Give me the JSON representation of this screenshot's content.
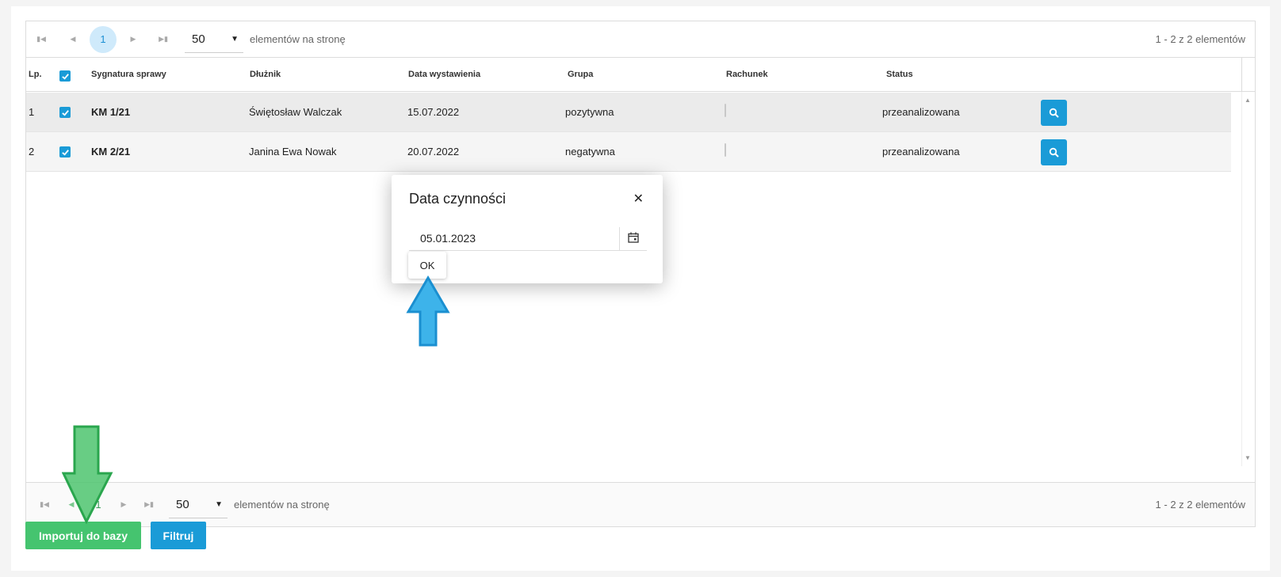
{
  "pager_top": {
    "first_icon": "first-page-icon",
    "prev_icon": "prev-page-icon",
    "current_page": "1",
    "next_icon": "next-page-icon",
    "last_icon": "last-page-icon",
    "page_size": "50",
    "page_size_label": "elementów na stronę",
    "info": "1 - 2 z 2 elementów"
  },
  "pager_bottom": {
    "current_page": "1",
    "page_size": "50",
    "page_size_label": "elementów na stronę",
    "info": "1 - 2 z 2 elementów"
  },
  "table": {
    "columns": [
      "Lp.",
      "Sygnatura sprawy",
      "Dłużnik",
      "Data wystawienia",
      "Grupa",
      "Rachunek",
      "Status"
    ],
    "rows": [
      {
        "lp": "1",
        "checked": true,
        "sygnatura": "KM 1/21",
        "dluznik": "Świętosław Walczak",
        "data": "15.07.2022",
        "grupa": "pozytywna",
        "rachunek": false,
        "status": "przeanalizowana"
      },
      {
        "lp": "2",
        "checked": true,
        "sygnatura": "KM 2/21",
        "dluznik": "Janina Ewa Nowak",
        "data": "20.07.2022",
        "grupa": "negatywna",
        "rachunek": false,
        "status": "przeanalizowana"
      }
    ]
  },
  "modal": {
    "title": "Data czynności",
    "date_value": "05.01.2023",
    "ok_label": "OK"
  },
  "buttons": {
    "import_label": "Importuj do bazy",
    "filter_label": "Filtruj"
  },
  "colors": {
    "primary": "#1a9bd7",
    "success": "#45c46f",
    "arrow_blue": "#3db3ea",
    "arrow_green": "#4ec46e"
  }
}
